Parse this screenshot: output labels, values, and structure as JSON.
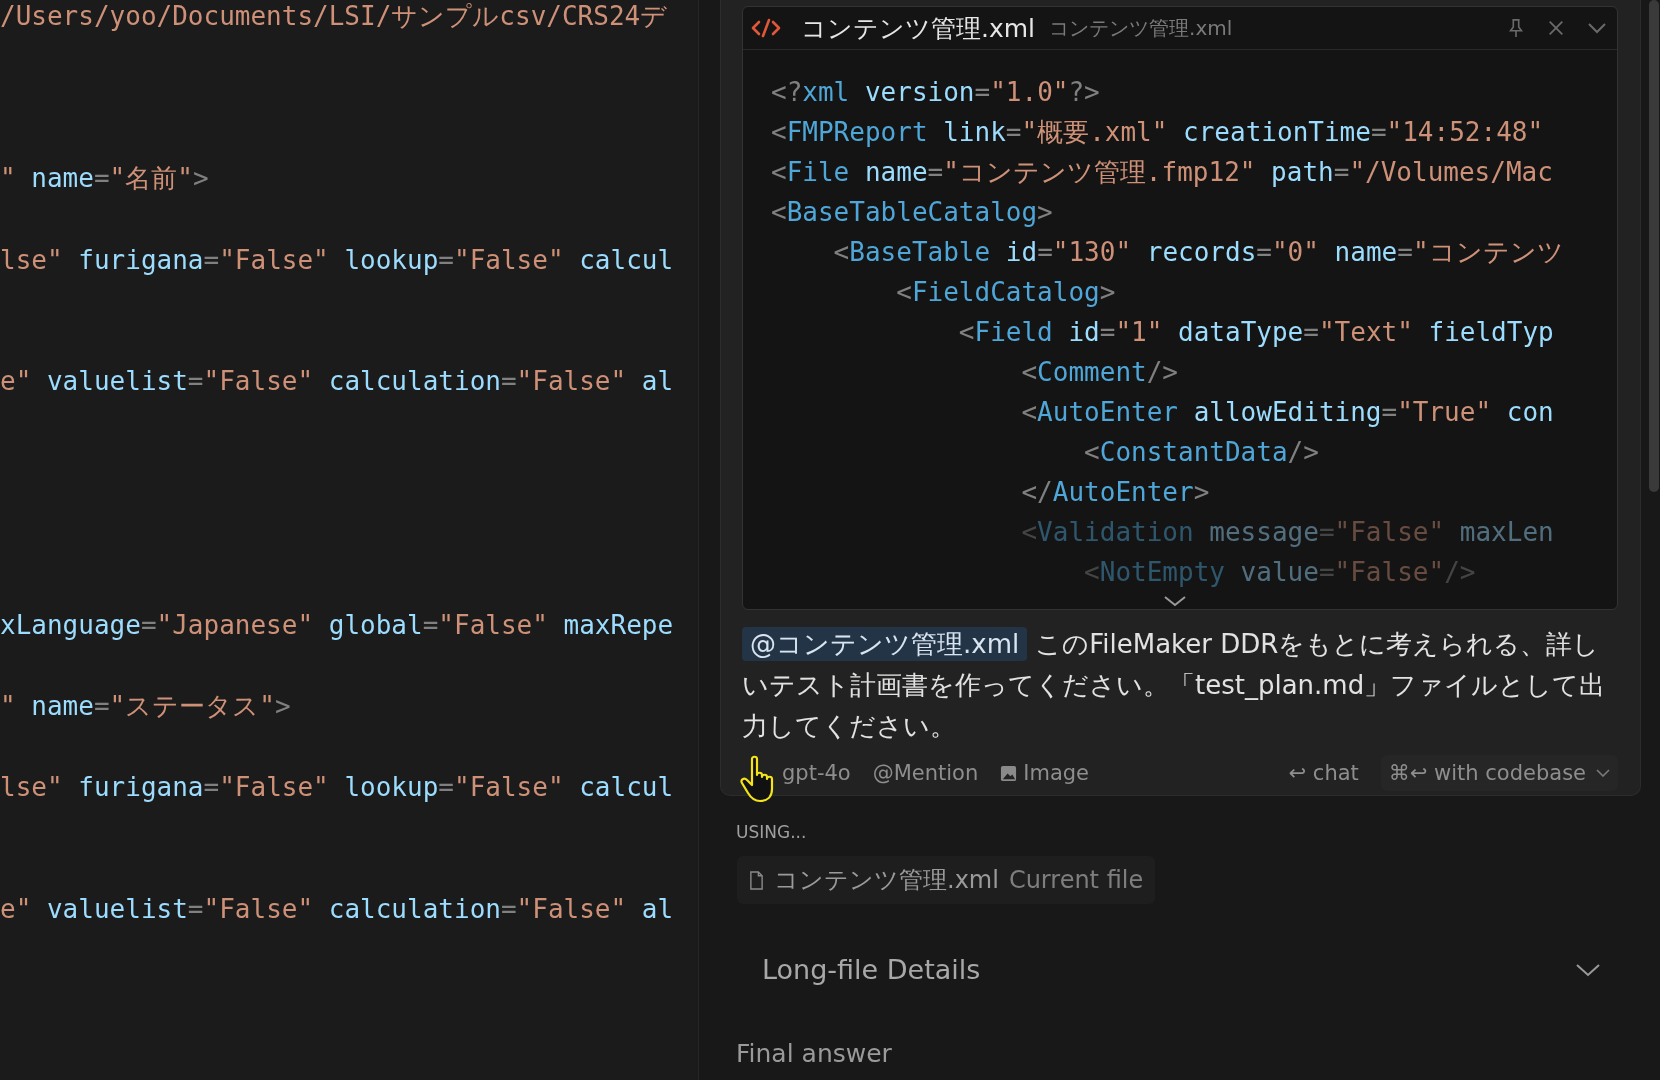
{
  "editor": {
    "lines": [
      {
        "tokens": [
          {
            "kind": "str",
            "text": "/Users/yoo/Documents/LSI/サンプルcsv/CRS24デ"
          }
        ]
      },
      {
        "tokens": [
          {
            "kind": "str",
            "text": "\""
          },
          {
            "kind": "attr",
            "text": " name"
          },
          {
            "kind": "punct",
            "text": "="
          },
          {
            "kind": "str",
            "text": "\"名前\""
          },
          {
            "kind": "punct",
            "text": ">"
          }
        ]
      },
      {
        "tokens": [
          {
            "kind": "str",
            "text": "lse\""
          },
          {
            "kind": "attr",
            "text": " furigana"
          },
          {
            "kind": "punct",
            "text": "="
          },
          {
            "kind": "str",
            "text": "\"False\""
          },
          {
            "kind": "attr",
            "text": " lookup"
          },
          {
            "kind": "punct",
            "text": "="
          },
          {
            "kind": "str",
            "text": "\"False\""
          },
          {
            "kind": "attr",
            "text": " calcul"
          }
        ]
      },
      {
        "tokens": [
          {
            "kind": "str",
            "text": "e\""
          },
          {
            "kind": "attr",
            "text": " valuelist"
          },
          {
            "kind": "punct",
            "text": "="
          },
          {
            "kind": "str",
            "text": "\"False\""
          },
          {
            "kind": "attr",
            "text": " calculation"
          },
          {
            "kind": "punct",
            "text": "="
          },
          {
            "kind": "str",
            "text": "\"False\""
          },
          {
            "kind": "attr",
            "text": " al"
          }
        ]
      },
      {
        "tokens": [
          {
            "kind": "attr",
            "text": "xLanguage"
          },
          {
            "kind": "punct",
            "text": "="
          },
          {
            "kind": "str",
            "text": "\"Japanese\""
          },
          {
            "kind": "attr",
            "text": " global"
          },
          {
            "kind": "punct",
            "text": "="
          },
          {
            "kind": "str",
            "text": "\"False\""
          },
          {
            "kind": "attr",
            "text": " maxRepe"
          }
        ]
      },
      {
        "tokens": [
          {
            "kind": "str",
            "text": "\""
          },
          {
            "kind": "attr",
            "text": " name"
          },
          {
            "kind": "punct",
            "text": "="
          },
          {
            "kind": "str",
            "text": "\"ステータス\""
          },
          {
            "kind": "punct",
            "text": ">"
          }
        ]
      },
      {
        "tokens": [
          {
            "kind": "str",
            "text": "lse\""
          },
          {
            "kind": "attr",
            "text": " furigana"
          },
          {
            "kind": "punct",
            "text": "="
          },
          {
            "kind": "str",
            "text": "\"False\""
          },
          {
            "kind": "attr",
            "text": " lookup"
          },
          {
            "kind": "punct",
            "text": "="
          },
          {
            "kind": "str",
            "text": "\"False\""
          },
          {
            "kind": "attr",
            "text": " calcul"
          }
        ]
      },
      {
        "tokens": [
          {
            "kind": "str",
            "text": "e\""
          },
          {
            "kind": "attr",
            "text": " valuelist"
          },
          {
            "kind": "punct",
            "text": "="
          },
          {
            "kind": "str",
            "text": "\"False\""
          },
          {
            "kind": "attr",
            "text": " calculation"
          },
          {
            "kind": "punct",
            "text": "="
          },
          {
            "kind": "str",
            "text": "\"False\""
          },
          {
            "kind": "attr",
            "text": " al"
          }
        ]
      }
    ]
  },
  "context_preview": {
    "title": "コンテンツ管理.xml",
    "subtitle": "コンテンツ管理.xml",
    "lines": [
      {
        "tokens": [
          {
            "kind": "punct",
            "text": "<?"
          },
          {
            "kind": "tag",
            "text": "xml"
          },
          {
            "kind": "attr",
            "text": " version"
          },
          {
            "kind": "punct",
            "text": "="
          },
          {
            "kind": "str",
            "text": "\"1.0\""
          },
          {
            "kind": "punct",
            "text": "?>"
          }
        ]
      },
      {
        "tokens": [
          {
            "kind": "punct",
            "text": "<"
          },
          {
            "kind": "tag",
            "text": "FMPReport"
          },
          {
            "kind": "attr",
            "text": " link"
          },
          {
            "kind": "punct",
            "text": "="
          },
          {
            "kind": "str",
            "text": "\"概要.xml\""
          },
          {
            "kind": "attr",
            "text": " creationTime"
          },
          {
            "kind": "punct",
            "text": "="
          },
          {
            "kind": "str",
            "text": "\"14:52:48\""
          }
        ]
      },
      {
        "tokens": [
          {
            "kind": "punct",
            "text": "<"
          },
          {
            "kind": "tag",
            "text": "File"
          },
          {
            "kind": "attr",
            "text": " name"
          },
          {
            "kind": "punct",
            "text": "="
          },
          {
            "kind": "str",
            "text": "\"コンテンツ管理.fmp12\""
          },
          {
            "kind": "attr",
            "text": " path"
          },
          {
            "kind": "punct",
            "text": "="
          },
          {
            "kind": "str",
            "text": "\"/Volumes/Mac"
          }
        ]
      },
      {
        "tokens": [
          {
            "kind": "punct",
            "text": "<"
          },
          {
            "kind": "tag",
            "text": "BaseTableCatalog"
          },
          {
            "kind": "punct",
            "text": ">"
          }
        ]
      },
      {
        "tokens": [
          {
            "kind": "punct",
            "text": "    <"
          },
          {
            "kind": "tag",
            "text": "BaseTable"
          },
          {
            "kind": "attr",
            "text": " id"
          },
          {
            "kind": "punct",
            "text": "="
          },
          {
            "kind": "str",
            "text": "\"130\""
          },
          {
            "kind": "attr",
            "text": " records"
          },
          {
            "kind": "punct",
            "text": "="
          },
          {
            "kind": "str",
            "text": "\"0\""
          },
          {
            "kind": "attr",
            "text": " name"
          },
          {
            "kind": "punct",
            "text": "="
          },
          {
            "kind": "str",
            "text": "\"コンテンツ"
          }
        ]
      },
      {
        "tokens": [
          {
            "kind": "punct",
            "text": "        <"
          },
          {
            "kind": "tag",
            "text": "FieldCatalog"
          },
          {
            "kind": "punct",
            "text": ">"
          }
        ]
      },
      {
        "tokens": [
          {
            "kind": "punct",
            "text": "            <"
          },
          {
            "kind": "tag",
            "text": "Field"
          },
          {
            "kind": "attr",
            "text": " id"
          },
          {
            "kind": "punct",
            "text": "="
          },
          {
            "kind": "str",
            "text": "\"1\""
          },
          {
            "kind": "attr",
            "text": " dataType"
          },
          {
            "kind": "punct",
            "text": "="
          },
          {
            "kind": "str",
            "text": "\"Text\""
          },
          {
            "kind": "attr",
            "text": " fieldTyp"
          }
        ]
      },
      {
        "tokens": [
          {
            "kind": "punct",
            "text": "                <"
          },
          {
            "kind": "tag",
            "text": "Comment"
          },
          {
            "kind": "punct",
            "text": "/>"
          }
        ]
      },
      {
        "tokens": [
          {
            "kind": "punct",
            "text": "                <"
          },
          {
            "kind": "tag",
            "text": "AutoEnter"
          },
          {
            "kind": "attr",
            "text": " allowEditing"
          },
          {
            "kind": "punct",
            "text": "="
          },
          {
            "kind": "str",
            "text": "\"True\""
          },
          {
            "kind": "attr",
            "text": " con"
          }
        ]
      },
      {
        "tokens": [
          {
            "kind": "punct",
            "text": "                    <"
          },
          {
            "kind": "tag",
            "text": "ConstantData"
          },
          {
            "kind": "punct",
            "text": "/>"
          }
        ]
      },
      {
        "tokens": [
          {
            "kind": "punct",
            "text": "                </"
          },
          {
            "kind": "tag",
            "text": "AutoEnter"
          },
          {
            "kind": "punct",
            "text": ">"
          }
        ]
      },
      {
        "tokens": [
          {
            "kind": "punct",
            "text": "                <"
          },
          {
            "kind": "tag",
            "text": "Validation"
          },
          {
            "kind": "attr",
            "text": " message"
          },
          {
            "kind": "punct",
            "text": "="
          },
          {
            "kind": "str",
            "text": "\"False\""
          },
          {
            "kind": "attr",
            "text": " maxLen"
          }
        ]
      },
      {
        "tokens": [
          {
            "kind": "punct",
            "text": "                    <"
          },
          {
            "kind": "tag",
            "text": "NotEmpty"
          },
          {
            "kind": "attr",
            "text": " value"
          },
          {
            "kind": "punct",
            "text": "="
          },
          {
            "kind": "str",
            "text": "\"False\""
          },
          {
            "kind": "punct",
            "text": "/>"
          }
        ]
      }
    ]
  },
  "prompt": {
    "mention": "@コンテンツ管理.xml",
    "text": "このFileMaker DDRをもとに考えられる、詳しいテスト計画書を作ってください。「test_plan.md」ファイルとして出力してください。"
  },
  "toolbar": {
    "model": "gpt-4o",
    "mention": {
      "icon": "@",
      "label": "Mention"
    },
    "image": "Image",
    "chat": {
      "icon": "↩",
      "label": "chat"
    },
    "codebase": {
      "icon": "⌘↩",
      "label": "with codebase"
    }
  },
  "using": {
    "heading": "USING...",
    "file": "コンテンツ管理.xml",
    "note": "Current file"
  },
  "details": {
    "title": "Long-file Details",
    "expanded": false
  },
  "final_answer": "Final answer"
}
